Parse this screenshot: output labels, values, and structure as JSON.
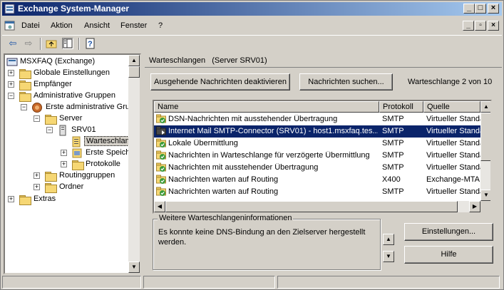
{
  "window": {
    "title": "Exchange System-Manager"
  },
  "menu": {
    "items": [
      "Datei",
      "Aktion",
      "Ansicht",
      "Fenster",
      "?"
    ]
  },
  "tree": {
    "nodes": [
      {
        "label": "MSXFAQ (Exchange)"
      },
      {
        "label": "Globale Einstellungen"
      },
      {
        "label": "Empfänger"
      },
      {
        "label": "Administrative Gruppen"
      },
      {
        "label": "Erste administrative Gruppe"
      },
      {
        "label": "Server"
      },
      {
        "label": "SRV01"
      },
      {
        "label": "Warteschlangen"
      },
      {
        "label": "Erste Speichergruppe"
      },
      {
        "label": "Protokolle"
      },
      {
        "label": "Routinggruppen"
      },
      {
        "label": "Ordner"
      },
      {
        "label": "Extras"
      }
    ]
  },
  "pane": {
    "title": "Warteschlangen",
    "subtitle": "(Server SRV01)",
    "btn_disable": "Ausgehende Nachrichten deaktivieren",
    "btn_find": "Nachrichten suchen...",
    "queue_count": "Warteschlange 2 von 10",
    "columns": [
      "Name",
      "Protokoll",
      "Quelle"
    ],
    "rows": [
      {
        "name": "DSN-Nachrichten mit ausstehender Übertragung",
        "protocol": "SMTP",
        "source": "Virtueller Standa"
      },
      {
        "name": "Internet Mail SMTP-Connector (SRV01) - host1.msxfaq.tes...",
        "protocol": "SMTP",
        "source": "Virtueller Standa"
      },
      {
        "name": "Lokale Übermittlung",
        "protocol": "SMTP",
        "source": "Virtueller Standa"
      },
      {
        "name": "Nachrichten in Warteschlange für verzögerte Übermittlung",
        "protocol": "SMTP",
        "source": "Virtueller Standa"
      },
      {
        "name": "Nachrichten mit ausstehender Übertragung",
        "protocol": "SMTP",
        "source": "Virtueller Standa"
      },
      {
        "name": "Nachrichten warten auf Routing",
        "protocol": "X400",
        "source": "Exchange-MTA"
      },
      {
        "name": "Nachrichten warten auf Routing",
        "protocol": "SMTP",
        "source": "Virtueller Standa"
      }
    ],
    "info_legend": "Weitere Warteschlangeninformationen",
    "info_text": "Es konnte keine DNS-Bindung an den Zielserver hergestellt werden.",
    "btn_settings": "Einstellungen...",
    "btn_help": "Hilfe"
  },
  "colors": {
    "titlebar": "#0a246a",
    "selection": "#0a246a",
    "face": "#d4d0c8"
  }
}
